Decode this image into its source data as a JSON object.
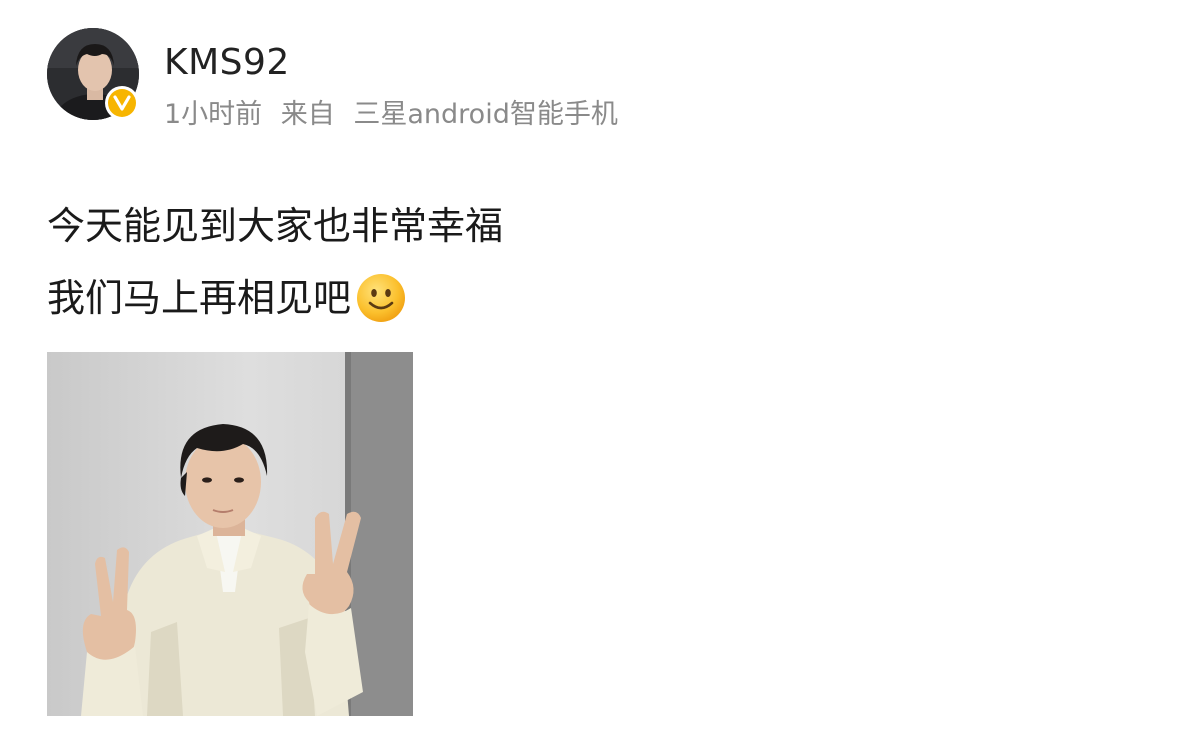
{
  "post": {
    "author": {
      "username": "KMS92",
      "verified": true,
      "badge_color": "#f7b500"
    },
    "meta": {
      "time": "1小时前",
      "source_prefix": "来自",
      "source": "三星android智能手机"
    },
    "content": {
      "line1": "今天能见到大家也非常幸福",
      "line2": "我们马上再相见吧",
      "emoji": "smile-emoji"
    },
    "image": {
      "icon": "photo-of-person-peace-sign"
    }
  }
}
